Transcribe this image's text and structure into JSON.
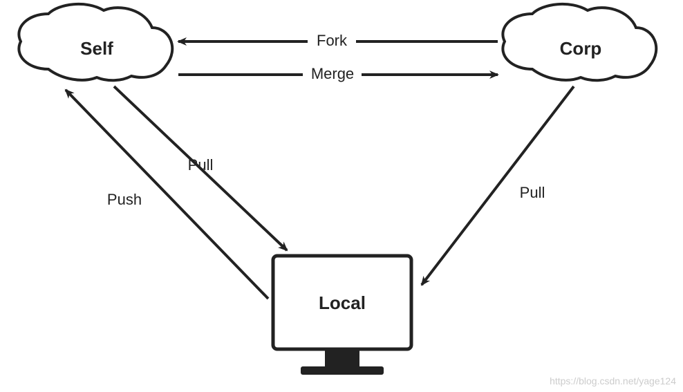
{
  "nodes": {
    "self": {
      "label": "Self"
    },
    "corp": {
      "label": "Corp"
    },
    "local": {
      "label": "Local"
    }
  },
  "edges": {
    "fork": {
      "label": "Fork",
      "from": "corp",
      "to": "self"
    },
    "merge": {
      "label": "Merge",
      "from": "self",
      "to": "corp"
    },
    "push": {
      "label": "Push",
      "from": "local",
      "to": "self"
    },
    "pull_self": {
      "label": "Pull",
      "from": "self",
      "to": "local"
    },
    "pull_corp": {
      "label": "Pull",
      "from": "corp",
      "to": "local"
    }
  },
  "watermark": "https://blog.csdn.net/yage124"
}
